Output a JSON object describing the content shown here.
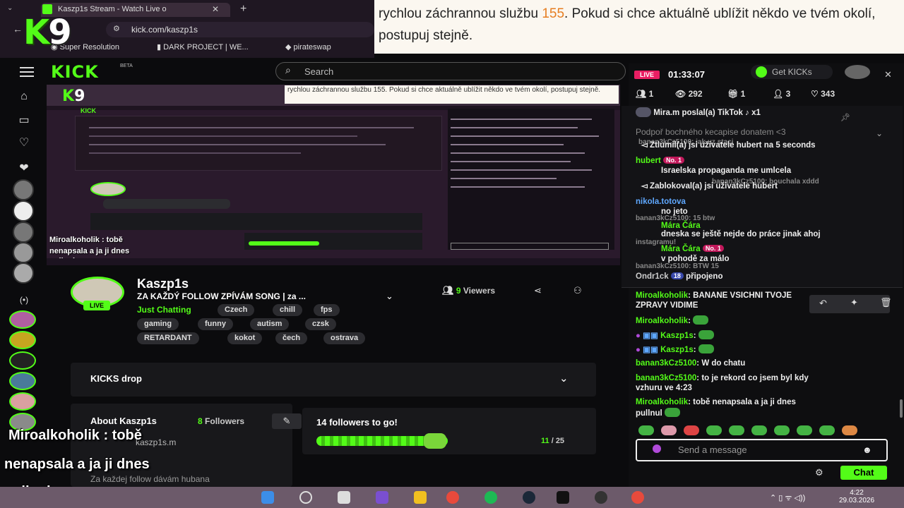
{
  "browser": {
    "tab_title": "Kaszp1s Stream - Watch Live o",
    "url": "kick.com/kaszp1s",
    "bookmarks": [
      "Super Resolution",
      "DARK PROJECT | WE...",
      "pirateswap"
    ]
  },
  "caption": {
    "text_before": "rychlou záchrannou službu ",
    "highlight": "155",
    "text_after": ". Pokud si chce aktuálně ublížit někdo ve tvém okolí, postupuj stejně."
  },
  "logo": {
    "k": "K",
    "nine": "9"
  },
  "kick": {
    "logo": "KICK",
    "beta": "BETA",
    "search_placeholder": "Search"
  },
  "preview_caption": "rychlou záchrannou službu 155. Pokud si chce aktuálně ublížit někdo ve tvém okolí, postupuj stejně.",
  "channel": {
    "name": "Kaszp1s",
    "title": "ZA KAŽDÝ FOLLOW ZPÍVÁM SONG | za ...",
    "live_label": "LIVE",
    "category": "Just Chatting",
    "tags": [
      "Czech",
      "chill",
      "fps",
      "gaming",
      "funny",
      "autism",
      "czsk",
      "RETARDANT",
      "kokot",
      "čech",
      "ostrava"
    ],
    "viewers_count": "9",
    "viewers_label": "Viewers"
  },
  "kicks_drop": {
    "title": "KICKS drop"
  },
  "about": {
    "title": "About Kaszp1s",
    "followers_count": "8",
    "followers_label": "Followers",
    "handle": "kaszp1s.m",
    "description": "Za každej follow dávám hubana"
  },
  "goal": {
    "title": "14 followers to go!",
    "current": "11",
    "target": "/ 25",
    "progress": 0.44
  },
  "overlay": {
    "line1_name": "Miroalkoholik",
    "line1_text": " : tobě",
    "line2": "nenapsala a ja ji dnes",
    "line3": "pullnul"
  },
  "chat": {
    "live_tag": "LIVE",
    "uptime": "01:33:07",
    "get_kicks": "Get KICKs",
    "stats": {
      "a": "1",
      "b": "292",
      "c": "1",
      "d": "3",
      "e": "343"
    },
    "pinned_header": "Mira.m poslal(a) TikTok",
    "pinned_mult": "x1",
    "support_text": "Podpoř bochného kecapise donatem <3",
    "lines": [
      {
        "u": "",
        "t": "Ztlumil(a) jsi uživatele hubert na 5 seconds"
      },
      {
        "u": "hubert",
        "t": "Israelska propaganda me umlcela"
      },
      {
        "u": "",
        "t": "Zablokoval(a) jsi uživatele hubert"
      },
      {
        "u": "nikola.totova",
        "t": "no jeto"
      },
      {
        "u": "Mára Čára",
        "t": "dneska se ještě nejde do práce jinak ahoj"
      },
      {
        "u": "Mára Čára",
        "t": "v pohodě za málo"
      },
      {
        "u": "Ondr1ck",
        "t": "připojeno"
      }
    ],
    "dim_lines": [
      "banan3kCz5100: jak uz staci",
      "banan3kCz5100: bouchala xddd",
      "banan3kCz5100: 15 btw",
      "instagramu!",
      "banan3kCz5100: BTW 15"
    ],
    "messages": [
      {
        "u": "Miroalkoholik",
        "t": ": BANANE VSICHNI TVOJE"
      },
      {
        "u": "",
        "t": "ZPRAVY VIDIME"
      },
      {
        "u": "Miroalkoholik",
        "t": ":"
      },
      {
        "u": "Kaszp1s",
        "t": ":"
      },
      {
        "u": "Kaszp1s",
        "t": ":"
      },
      {
        "u": "banan3kCz5100",
        "t": ": W do chatu"
      },
      {
        "u": "banan3kCz5100",
        "t": ": to je rekord co jsem byl kdy"
      },
      {
        "u": "",
        "t": "vzhuru ve 4:23"
      },
      {
        "u": "Miroalkoholik",
        "t": ": tobě nenapsala a ja ji dnes"
      },
      {
        "u": "",
        "t": "pullnul"
      }
    ],
    "input_placeholder": "Send a message",
    "send_label": "Chat"
  },
  "taskbar": {
    "time": "4:22",
    "date": "29.03.2026"
  },
  "colors": {
    "accent": "#53fc18",
    "live": "#e91e63",
    "caption_highlight": "#e67e22"
  }
}
